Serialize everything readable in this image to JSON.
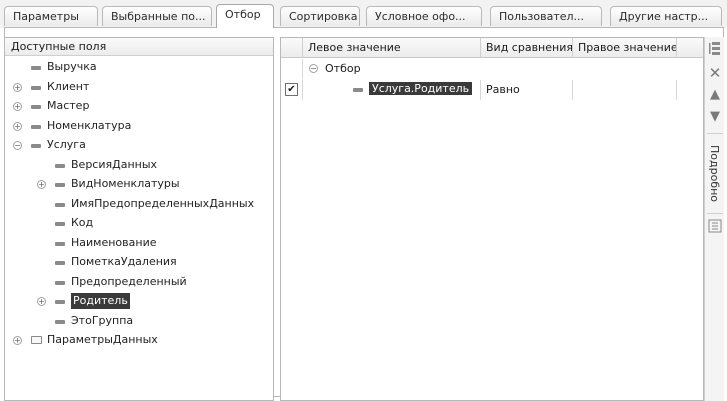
{
  "tabs": [
    {
      "label": "Параметры"
    },
    {
      "label": "Выбранные по..."
    },
    {
      "label": "Отбор"
    },
    {
      "label": "Сортировка"
    },
    {
      "label": "Условное офо..."
    },
    {
      "label": "Пользовател..."
    },
    {
      "label": "Другие настр..."
    }
  ],
  "active_tab": "Отбор",
  "left_pane": {
    "header": "Доступные поля",
    "tree": [
      {
        "label": "Выручка",
        "depth": 0,
        "expandable": false,
        "icon": "field-icon"
      },
      {
        "label": "Клиент",
        "depth": 0,
        "expandable": true,
        "expanded": false,
        "icon": "field-icon"
      },
      {
        "label": "Мастер",
        "depth": 0,
        "expandable": true,
        "expanded": false,
        "icon": "field-icon"
      },
      {
        "label": "Номенклатура",
        "depth": 0,
        "expandable": true,
        "expanded": false,
        "icon": "field-icon"
      },
      {
        "label": "Услуга",
        "depth": 0,
        "expandable": true,
        "expanded": true,
        "icon": "field-icon"
      },
      {
        "label": "ВерсияДанных",
        "depth": 1,
        "expandable": false,
        "icon": "field-icon"
      },
      {
        "label": "ВидНоменклатуры",
        "depth": 1,
        "expandable": true,
        "expanded": false,
        "icon": "field-icon"
      },
      {
        "label": "ИмяПредопределенныхДанных",
        "depth": 1,
        "expandable": false,
        "icon": "field-icon"
      },
      {
        "label": "Код",
        "depth": 1,
        "expandable": false,
        "icon": "field-icon"
      },
      {
        "label": "Наименование",
        "depth": 1,
        "expandable": false,
        "icon": "field-icon"
      },
      {
        "label": "ПометкаУдаления",
        "depth": 1,
        "expandable": false,
        "icon": "field-icon"
      },
      {
        "label": "Предопределенный",
        "depth": 1,
        "expandable": false,
        "icon": "field-icon"
      },
      {
        "label": "Родитель",
        "depth": 1,
        "expandable": true,
        "expanded": false,
        "icon": "field-icon",
        "selected": true
      },
      {
        "label": "ЭтоГруппа",
        "depth": 1,
        "expandable": false,
        "icon": "field-icon"
      },
      {
        "label": "ПараметрыДанных",
        "depth": 0,
        "expandable": true,
        "expanded": false,
        "icon": "folder-icon"
      }
    ]
  },
  "right_pane": {
    "columns": [
      "Левое значение",
      "Вид сравнения",
      "Правое значение"
    ],
    "group_label": "Отбор",
    "rows": [
      {
        "checked": true,
        "left": "Услуга.Родитель",
        "comparison": "Равно",
        "right": ""
      }
    ]
  },
  "toolbar": {
    "vertical_label": "Подробно",
    "buttons": [
      "group-conditions-icon",
      "delete-icon",
      "move-up-icon",
      "move-down-icon",
      "more-icon"
    ]
  }
}
